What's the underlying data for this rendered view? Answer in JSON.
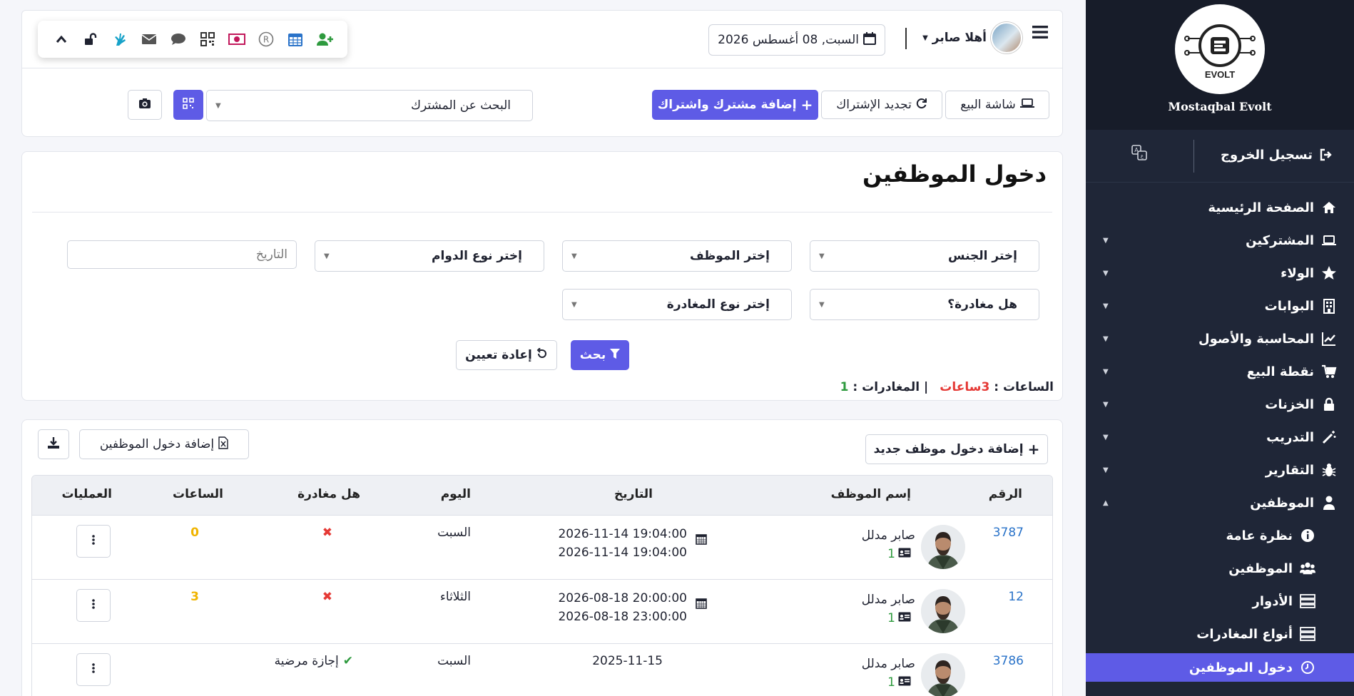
{
  "sidebar": {
    "brand": "Mostaqbal Evolt",
    "logout_label": "تسجيل الخروج",
    "items": [
      {
        "label": "الصفحة الرئيسية"
      },
      {
        "label": "المشتركين"
      },
      {
        "label": "الولاء"
      },
      {
        "label": "البوابات"
      },
      {
        "label": "المحاسبة والأصول"
      },
      {
        "label": "نقطة البيع"
      },
      {
        "label": "الخزنات"
      },
      {
        "label": "التدريب"
      },
      {
        "label": "التقارير"
      },
      {
        "label": "الموظفين"
      }
    ],
    "sub_items": [
      {
        "label": "نظرة عامة"
      },
      {
        "label": "الموظفين"
      },
      {
        "label": "الأدوار"
      },
      {
        "label": "أنواع المغادرات"
      },
      {
        "label": "دخول الموظفين"
      }
    ]
  },
  "header": {
    "greeting": "أهلا صابر",
    "date": "السبت, 08 أغسطس 2026"
  },
  "actions": {
    "pos_label": "شاشة البيع",
    "renew_label": "تجديد الإشتراك",
    "add_sub_label": "إضافة مشترك واشتراك",
    "search_placeholder": "البحث عن المشترك"
  },
  "filters": {
    "title": "دخول الموظفين",
    "gender": "إختر الجنس",
    "employee": "إختر الموظف",
    "shift_type": "إختر نوع الدوام",
    "date_placeholder": "التاريخ",
    "is_leave": "هل مغادرة؟",
    "leave_type": "إختر نوع المغادرة",
    "search_label": "بحث",
    "reset_label": "إعادة تعيين",
    "hours_label": "الساعات :",
    "hours_value": "3ساعات",
    "leaves_label": "| المغادرات :",
    "leaves_value": "1"
  },
  "table": {
    "add_new_label": "إضافة دخول موظف جديد",
    "export_label": "إضافة دخول الموظفين",
    "columns": [
      "الرقم",
      "إسم الموظف",
      "التاريخ",
      "اليوم",
      "هل مغادرة",
      "الساعات",
      "العمليات"
    ],
    "rows": [
      {
        "id": "3787",
        "name": "صابر مدلل",
        "badge": "1",
        "date1": "2026-11-14 19:04:00",
        "date2": "2026-11-14 19:04:00",
        "day": "السبت",
        "leave": "",
        "hours": "0"
      },
      {
        "id": "12",
        "name": "صابر مدلل",
        "badge": "1",
        "date1": "2026-08-18 20:00:00",
        "date2": "2026-08-18 23:00:00",
        "day": "الثلاثاء",
        "leave": "",
        "hours": "3"
      },
      {
        "id": "3786",
        "name": "صابر مدلل",
        "badge": "1",
        "date1": "2025-11-15",
        "date2": "",
        "day": "السبت",
        "leave": "إجازة مرضية",
        "hours": ""
      }
    ]
  },
  "colors": {
    "primary": "#5e5be6",
    "sidebar": "#1f2637",
    "danger": "#e53935",
    "success": "#2e9a3e",
    "warning": "#f0b400",
    "link": "#2a73c9"
  }
}
